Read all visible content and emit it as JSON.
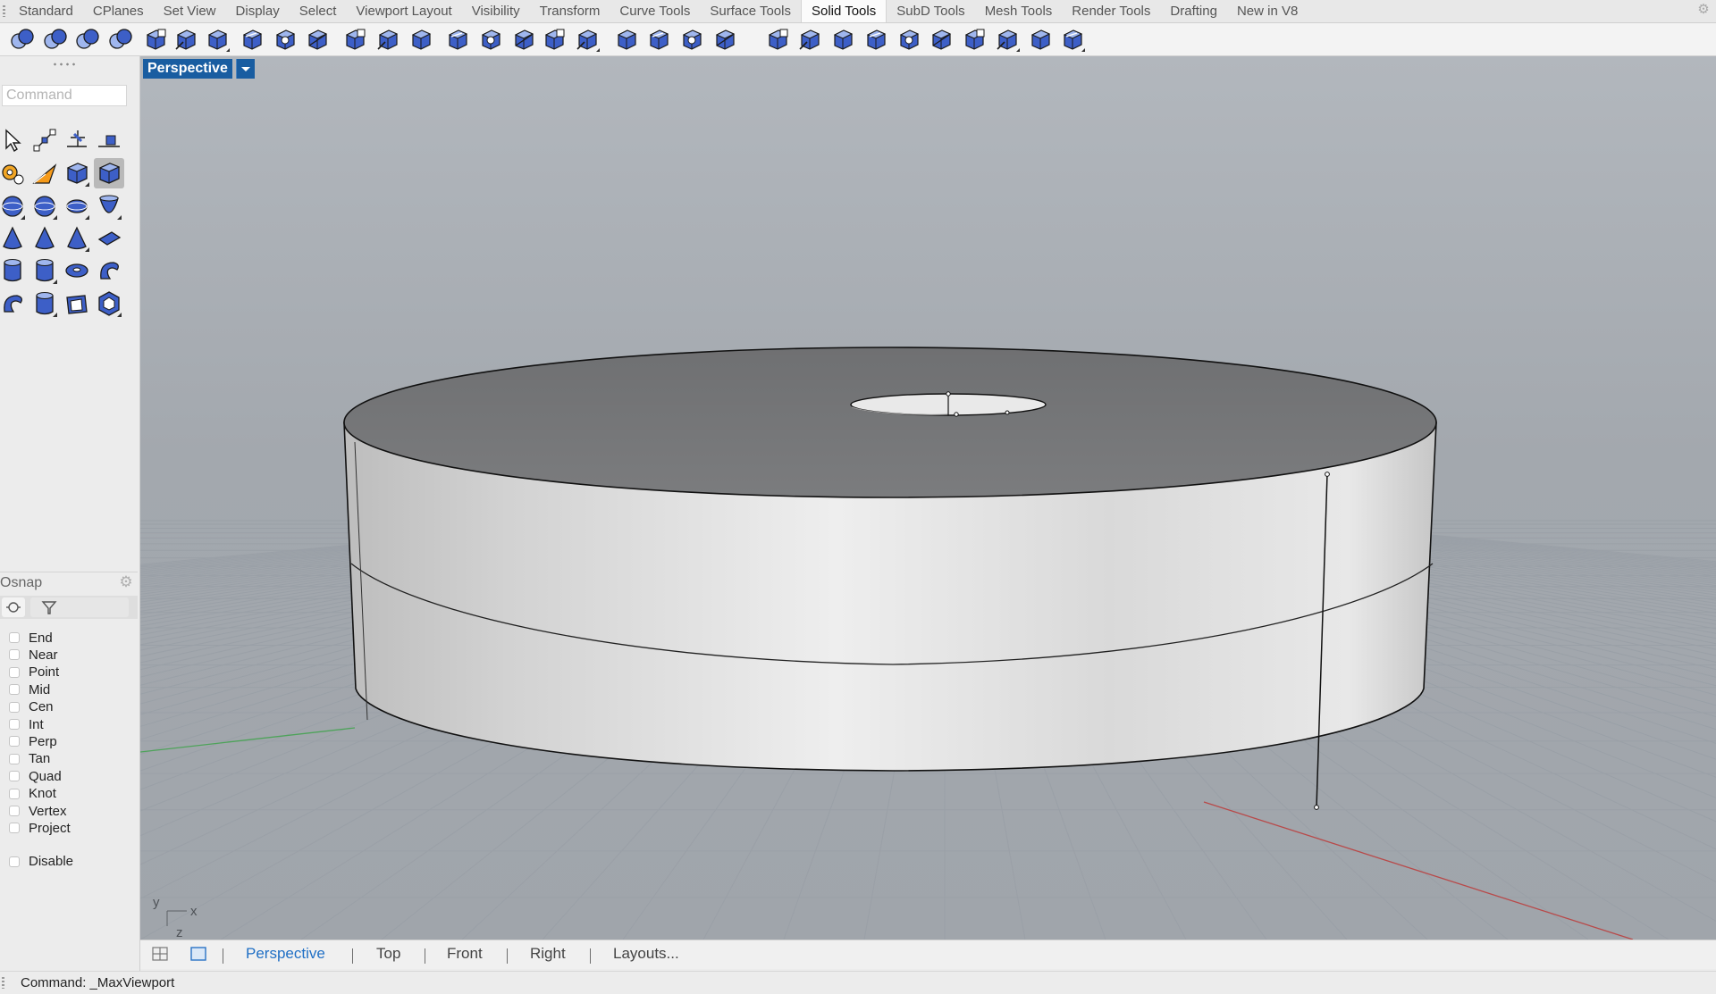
{
  "tabs": [
    {
      "label": "Standard"
    },
    {
      "label": "CPlanes"
    },
    {
      "label": "Set View"
    },
    {
      "label": "Display"
    },
    {
      "label": "Select"
    },
    {
      "label": "Viewport Layout"
    },
    {
      "label": "Visibility"
    },
    {
      "label": "Transform"
    },
    {
      "label": "Curve Tools"
    },
    {
      "label": "Surface Tools"
    },
    {
      "label": "Solid Tools",
      "active": true
    },
    {
      "label": "SubD Tools"
    },
    {
      "label": "Mesh Tools"
    },
    {
      "label": "Render Tools"
    },
    {
      "label": "Drafting"
    },
    {
      "label": "New in V8"
    }
  ],
  "toolbar_icons": [
    "boolean-union-icon",
    "boolean-difference-icon",
    "boolean-intersection-icon",
    "boolean-split-icon",
    "cap-planar-holes-icon",
    "extract-surface-icon",
    "merge-faces-icon",
    "offset-surface-icon",
    "box-solid-icon",
    "edit-solid-icon",
    "extrude-face-icon",
    "move-face-icon",
    "move-edge-icon",
    "loft-solid-icon",
    "split-face-icon",
    "shell-icon",
    "fillet-edge-icon",
    "chamfer-edge-icon",
    "extrude-curve-icon",
    "move-untrimmed-edge-icon",
    "rebuild-solid-icon",
    "surface-grid-icon",
    "solid-edit-icon",
    "cap-icon",
    "create-solid-icon",
    "wireframe-box-icon",
    "face-extrude-icon",
    "point-grid-icon",
    "mesh-grid-icon",
    "delete-face-icon",
    "bucket-icon",
    "gumball-icon"
  ],
  "command": {
    "placeholder": "Command"
  },
  "left_tools": [
    "select-arrow-icon",
    "control-points-icon",
    "point-edit-icon",
    "drag-mode-icon",
    "gear-edit-icon",
    "analyze-icon",
    "box-icon",
    "box-edit-icon",
    "sphere-icon",
    "sphere-options-icon",
    "ellipsoid-icon",
    "paraboloid-icon",
    "cone-icon",
    "pyramid-icon",
    "tetrahedron-icon",
    "truncated-cone-icon",
    "cylinder-icon",
    "tube-icon",
    "torus-icon",
    "pipe-icon",
    "revolve-icon",
    "slab-icon",
    "extrude-surface-icon",
    "solid-text-icon"
  ],
  "osnap": {
    "title": "Osnap",
    "items": [
      {
        "label": "End"
      },
      {
        "label": "Near"
      },
      {
        "label": "Point"
      },
      {
        "label": "Mid"
      },
      {
        "label": "Cen"
      },
      {
        "label": "Int"
      },
      {
        "label": "Perp"
      },
      {
        "label": "Tan"
      },
      {
        "label": "Quad"
      },
      {
        "label": "Knot"
      },
      {
        "label": "Vertex"
      },
      {
        "label": "Project"
      }
    ],
    "disable": "Disable"
  },
  "viewport": {
    "label": "Perspective",
    "axis_x": "x",
    "axis_y": "y",
    "axis_z": "z",
    "colors": {
      "background": "#a7acb2",
      "grid": "#9ba1a8",
      "x_axis": "#b84a4a",
      "y_axis": "#4ea35a",
      "solid_top": "#767779",
      "solid_side": "#d6d6d6",
      "active_label": "#195da1"
    }
  },
  "view_tabs": {
    "perspective": "Perspective",
    "top": "Top",
    "front": "Front",
    "right": "Right",
    "layouts": "Layouts..."
  },
  "status": {
    "text": "Command: _MaxViewport"
  }
}
